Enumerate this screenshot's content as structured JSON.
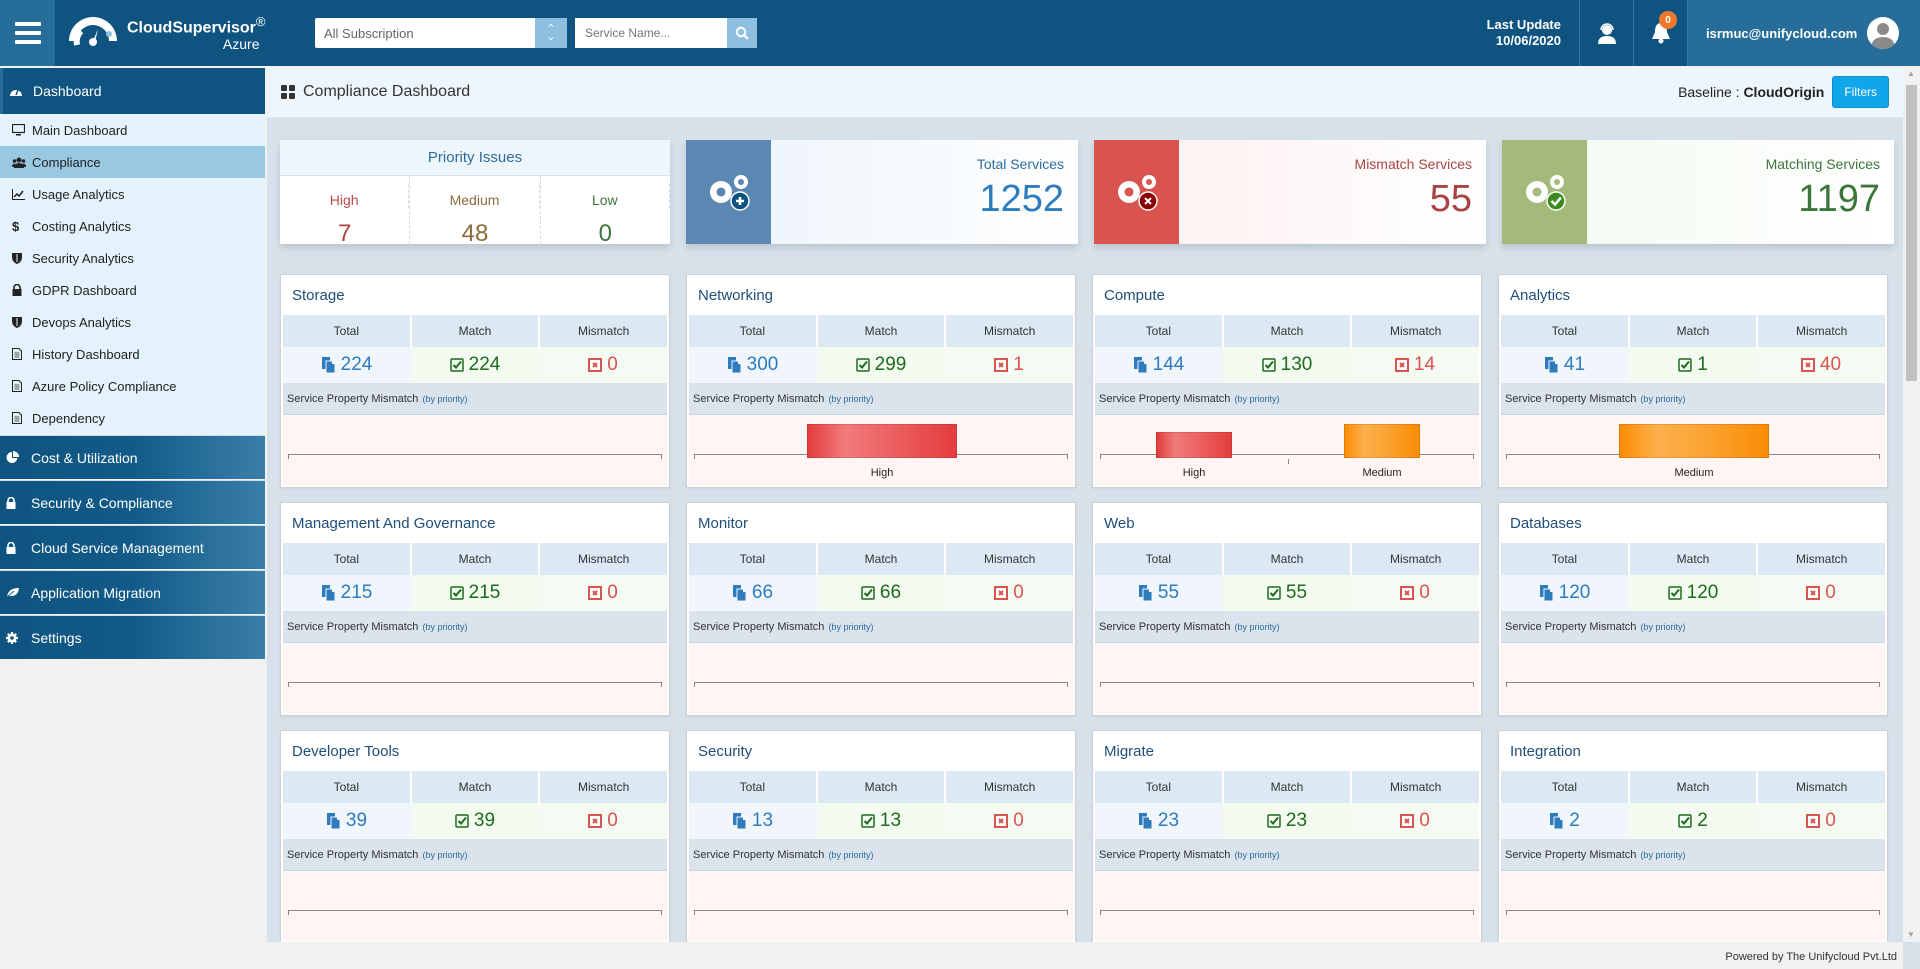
{
  "header": {
    "app_name": "CloudSupervisor",
    "registered": "®",
    "app_sub": "Azure",
    "subscription_select": "All Subscription",
    "service_search_placeholder": "Service Name...",
    "last_update_label": "Last Update",
    "last_update_date": "10/06/2020",
    "notification_count": "0",
    "user_email": "isrmuc@unifycloud.com"
  },
  "sidebar": {
    "section": "Dashboard",
    "items": [
      {
        "label": "Main Dashboard",
        "icon": "monitor-icon"
      },
      {
        "label": "Compliance",
        "icon": "users-icon",
        "active": true
      },
      {
        "label": "Usage Analytics",
        "icon": "line-chart-icon"
      },
      {
        "label": "Costing Analytics",
        "icon": "dollar-icon"
      },
      {
        "label": "Security Analytics",
        "icon": "shield-icon"
      },
      {
        "label": "GDPR Dashboard",
        "icon": "lock-icon"
      },
      {
        "label": "Devops Analytics",
        "icon": "shield-icon"
      },
      {
        "label": "History Dashboard",
        "icon": "document-icon"
      },
      {
        "label": "Azure Policy Compliance",
        "icon": "document-icon"
      },
      {
        "label": "Dependency",
        "icon": "document-icon"
      }
    ],
    "groups": [
      {
        "label": "Cost & Utilization",
        "icon": "pie-chart-icon"
      },
      {
        "label": "Security & Compliance",
        "icon": "lock-icon"
      },
      {
        "label": "Cloud Service Management",
        "icon": "lock-icon"
      },
      {
        "label": "Application Migration",
        "icon": "leaf-icon"
      },
      {
        "label": "Settings",
        "icon": "gear-icon"
      }
    ]
  },
  "page": {
    "title": "Compliance Dashboard",
    "baseline_label": "Baseline :",
    "baseline_value": "CloudOrigin",
    "filters_button": "Filters"
  },
  "priority": {
    "title": "Priority Issues",
    "high_label": "High",
    "high_value": "7",
    "medium_label": "Medium",
    "medium_value": "48",
    "low_label": "Low",
    "low_value": "0"
  },
  "stats": {
    "total": {
      "label": "Total Services",
      "value": "1252",
      "color": "#5b87b3"
    },
    "mismatch": {
      "label": "Mismatch Services",
      "value": "55",
      "color": "#d9534f"
    },
    "matching": {
      "label": "Matching Services",
      "value": "1197",
      "color": "#a5b97a"
    }
  },
  "card_labels": {
    "total": "Total",
    "match": "Match",
    "mismatch": "Mismatch",
    "spm": "Service Property Mismatch",
    "by_priority": "(by priority)"
  },
  "cards": [
    {
      "name": "Storage",
      "total": "224",
      "match": "224",
      "mismatch": "0",
      "bars": []
    },
    {
      "name": "Networking",
      "total": "300",
      "match": "299",
      "mismatch": "1",
      "bars": [
        {
          "priority": "High",
          "value": 1
        }
      ]
    },
    {
      "name": "Compute",
      "total": "144",
      "match": "130",
      "mismatch": "14",
      "bars": [
        {
          "priority": "High",
          "value": 6
        },
        {
          "priority": "Medium",
          "value": 8
        }
      ]
    },
    {
      "name": "Analytics",
      "total": "41",
      "match": "1",
      "mismatch": "40",
      "bars": [
        {
          "priority": "Medium",
          "value": 1
        }
      ]
    },
    {
      "name": "Management And Governance",
      "total": "215",
      "match": "215",
      "mismatch": "0",
      "bars": []
    },
    {
      "name": "Monitor",
      "total": "66",
      "match": "66",
      "mismatch": "0",
      "bars": []
    },
    {
      "name": "Web",
      "total": "55",
      "match": "55",
      "mismatch": "0",
      "bars": []
    },
    {
      "name": "Databases",
      "total": "120",
      "match": "120",
      "mismatch": "0",
      "bars": []
    },
    {
      "name": "Developer Tools",
      "total": "39",
      "match": "39",
      "mismatch": "0",
      "bars": []
    },
    {
      "name": "Security",
      "total": "13",
      "match": "13",
      "mismatch": "0",
      "bars": []
    },
    {
      "name": "Migrate",
      "total": "23",
      "match": "23",
      "mismatch": "0",
      "bars": []
    },
    {
      "name": "Integration",
      "total": "2",
      "match": "2",
      "mismatch": "0",
      "bars": []
    }
  ],
  "footer": "Powered by The Unifycloud Pvt.Ltd"
}
